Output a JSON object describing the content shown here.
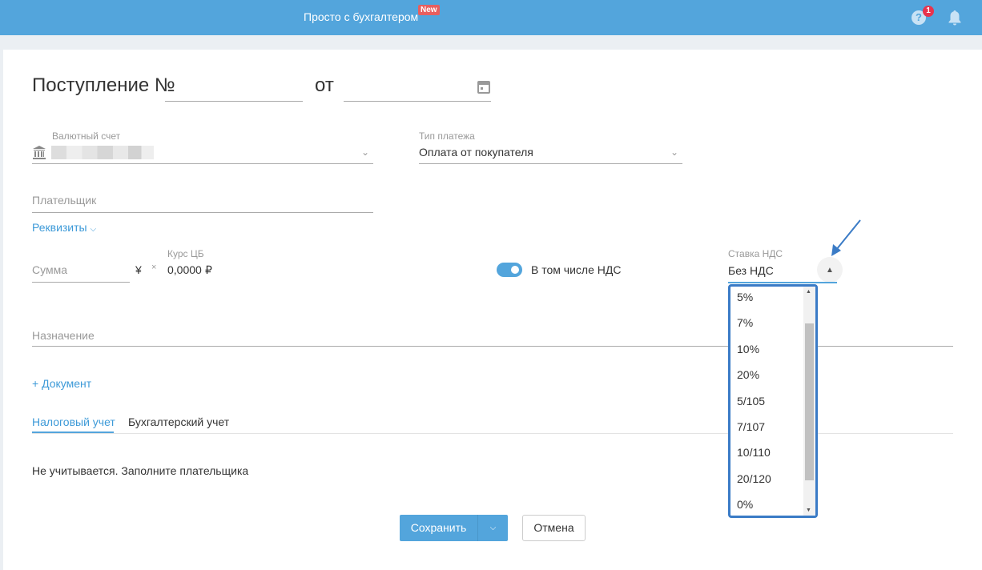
{
  "header": {
    "brand": "Просто с бухгалтером",
    "new_badge": "New",
    "help_badge": "1",
    "help_glyph": "?"
  },
  "form": {
    "title": "Поступление №",
    "from_label": "от",
    "number_value": "",
    "date_value": "",
    "account": {
      "label": "Валютный счет",
      "value": ""
    },
    "payment_type": {
      "label": "Тип платежа",
      "value": "Оплата от покупателя"
    },
    "payer": {
      "placeholder": "Плательщик"
    },
    "details_link": "Реквизиты",
    "amount": {
      "placeholder": "Сумма",
      "currency": "¥",
      "times": "×",
      "rate_label": "Курс ЦБ",
      "rate_value": "0,0000",
      "rate_currency": "₽"
    },
    "vat_included": {
      "label": "В том числе НДС",
      "on": true
    },
    "vat_rate": {
      "label": "Ставка НДС",
      "value": "Без НДС",
      "options": [
        "5%",
        "7%",
        "10%",
        "20%",
        "5/105",
        "7/107",
        "10/110",
        "20/120",
        "0%"
      ]
    },
    "purpose": {
      "placeholder": "Назначение"
    },
    "add_document": "+ Документ",
    "tabs": [
      "Налоговый учет",
      "Бухгалтерский учет"
    ],
    "tab_message": "Не учитывается. Заполните плательщика",
    "save": "Сохранить",
    "cancel": "Отмена"
  },
  "colors": {
    "accent": "#53a5dc",
    "badge": "#e8334d",
    "focus": "#3a7bc6"
  }
}
